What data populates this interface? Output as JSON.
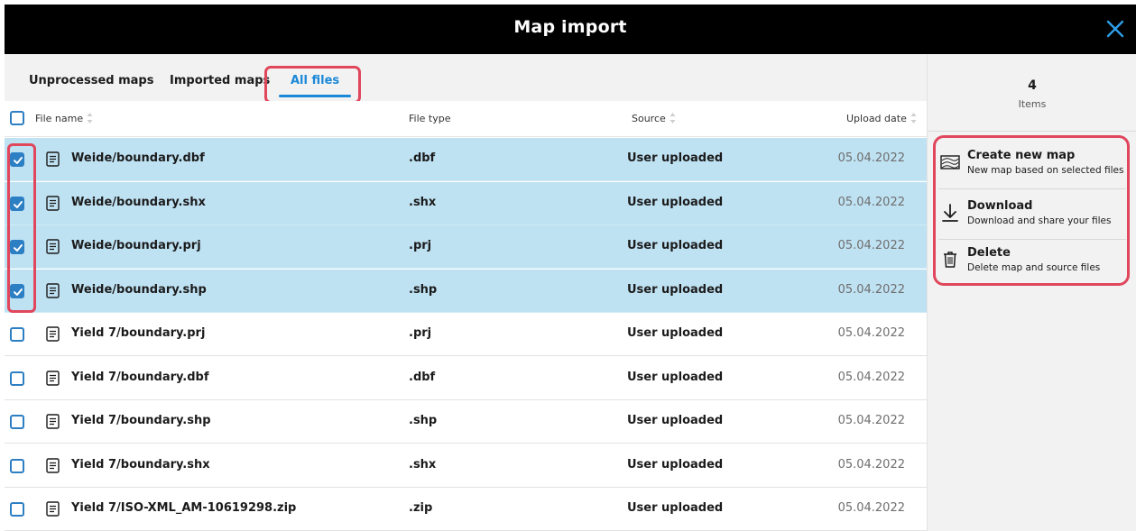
{
  "window": {
    "title": "Map import"
  },
  "tabs": [
    {
      "label": "Unprocessed maps"
    },
    {
      "label": "Imported maps"
    },
    {
      "label": "All files"
    }
  ],
  "table": {
    "columns": {
      "file_name": "File name",
      "file_type": "File type",
      "source": "Source",
      "upload_date": "Upload date"
    },
    "rows": [
      {
        "name": "Weide/boundary.dbf",
        "type": ".dbf",
        "source": "User uploaded",
        "date": "05.04.2022",
        "selected": true
      },
      {
        "name": "Weide/boundary.shx",
        "type": ".shx",
        "source": "User uploaded",
        "date": "05.04.2022",
        "selected": true
      },
      {
        "name": "Weide/boundary.prj",
        "type": ".prj",
        "source": "User uploaded",
        "date": "05.04.2022",
        "selected": true
      },
      {
        "name": "Weide/boundary.shp",
        "type": ".shp",
        "source": "User uploaded",
        "date": "05.04.2022",
        "selected": true
      },
      {
        "name": "Yield 7/boundary.prj",
        "type": ".prj",
        "source": "User uploaded",
        "date": "05.04.2022",
        "selected": false
      },
      {
        "name": "Yield 7/boundary.dbf",
        "type": ".dbf",
        "source": "User uploaded",
        "date": "05.04.2022",
        "selected": false
      },
      {
        "name": "Yield 7/boundary.shp",
        "type": ".shp",
        "source": "User uploaded",
        "date": "05.04.2022",
        "selected": false
      },
      {
        "name": "Yield 7/boundary.shx",
        "type": ".shx",
        "source": "User uploaded",
        "date": "05.04.2022",
        "selected": false
      },
      {
        "name": "Yield 7/ISO-XML_AM-10619298.zip",
        "type": ".zip",
        "source": "User uploaded",
        "date": "05.04.2022",
        "selected": false
      }
    ]
  },
  "sidebar": {
    "count": "4",
    "count_label": "Items",
    "actions": [
      {
        "title": "Create new map",
        "desc": "New map based on selected files",
        "icon": "map-icon"
      },
      {
        "title": "Download",
        "desc": "Download and share your files",
        "icon": "download-icon"
      },
      {
        "title": "Delete",
        "desc": "Delete map and source files",
        "icon": "trash-icon"
      }
    ]
  },
  "colors": {
    "accent": "#1a88d8",
    "selected_row": "#bfe2f3",
    "highlight": "#e0465c",
    "checkbox": "#2d7fc4"
  }
}
